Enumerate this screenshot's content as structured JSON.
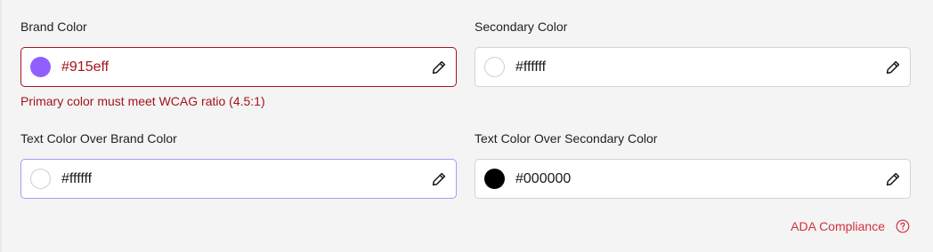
{
  "brand_color": {
    "label": "Brand Color",
    "value": "#915eff",
    "swatch": "#915eff",
    "error": "Primary color must meet WCAG ratio (4.5:1)",
    "edit_icon": "pencil-icon"
  },
  "secondary_color": {
    "label": "Secondary Color",
    "value": "#ffffff",
    "swatch": "#ffffff",
    "edit_icon": "pencil-icon"
  },
  "text_over_brand": {
    "label": "Text Color Over Brand Color",
    "value": "#ffffff",
    "swatch": "#ffffff",
    "edit_icon": "pencil-icon"
  },
  "text_over_secondary": {
    "label": "Text Color Over Secondary Color",
    "value": "#000000",
    "swatch": "#000000",
    "edit_icon": "pencil-icon"
  },
  "ada": {
    "label": "ADA Compliance",
    "icon": "help-circle-icon"
  },
  "colors": {
    "page_background": "#f4f4f4",
    "error": "#a3141d",
    "link": "#d0333d",
    "focus_border": "#a69cf0"
  }
}
